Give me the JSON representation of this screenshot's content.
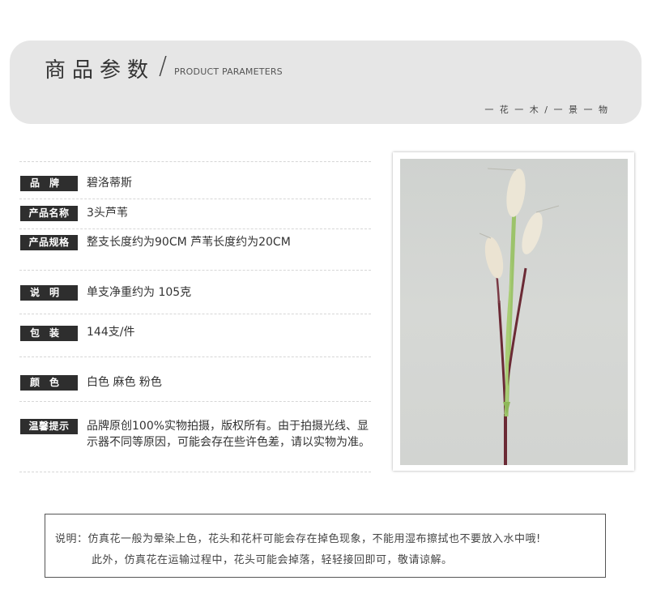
{
  "header": {
    "title_cn": "商品参数",
    "slash": "/",
    "title_en": "PRODUCT PARAMETERS",
    "motto": "一 花 一 木 / 一 景 一 物"
  },
  "params": [
    {
      "label": "品　牌",
      "value": "碧洛蒂斯"
    },
    {
      "label": "产品名称",
      "value": "3头芦苇"
    },
    {
      "label": "产品规格",
      "value": "整支长度约为90CM 芦苇长度约为20CM"
    },
    {
      "label": "说　明",
      "value": "单支净重约为 105克"
    },
    {
      "label": "包　装",
      "value": "144支/件"
    },
    {
      "label": "颜　色",
      "value": "白色 麻色 粉色"
    },
    {
      "label": "温馨提示",
      "value": "品牌原创100%实物拍摄，版权所有。由于拍摄光线、显示器不同等原因，可能会存在些许色差，请以实物为准。"
    }
  ],
  "note": {
    "line1": "说明：仿真花一般为晕染上色，花头和花杆可能会存在掉色现象，不能用湿布擦拭也不要放入水中哦!",
    "line2": "此外，仿真花在运输过程中，花头可能会掉落，轻轻接回即可，敬请谅解。"
  },
  "colors": {
    "header_band": "#e6e6e6",
    "label_bg": "#2e2e2e",
    "stem_green": "#9cc36a",
    "stem_purple": "#6b2a35",
    "plume": "#ece6d6"
  }
}
